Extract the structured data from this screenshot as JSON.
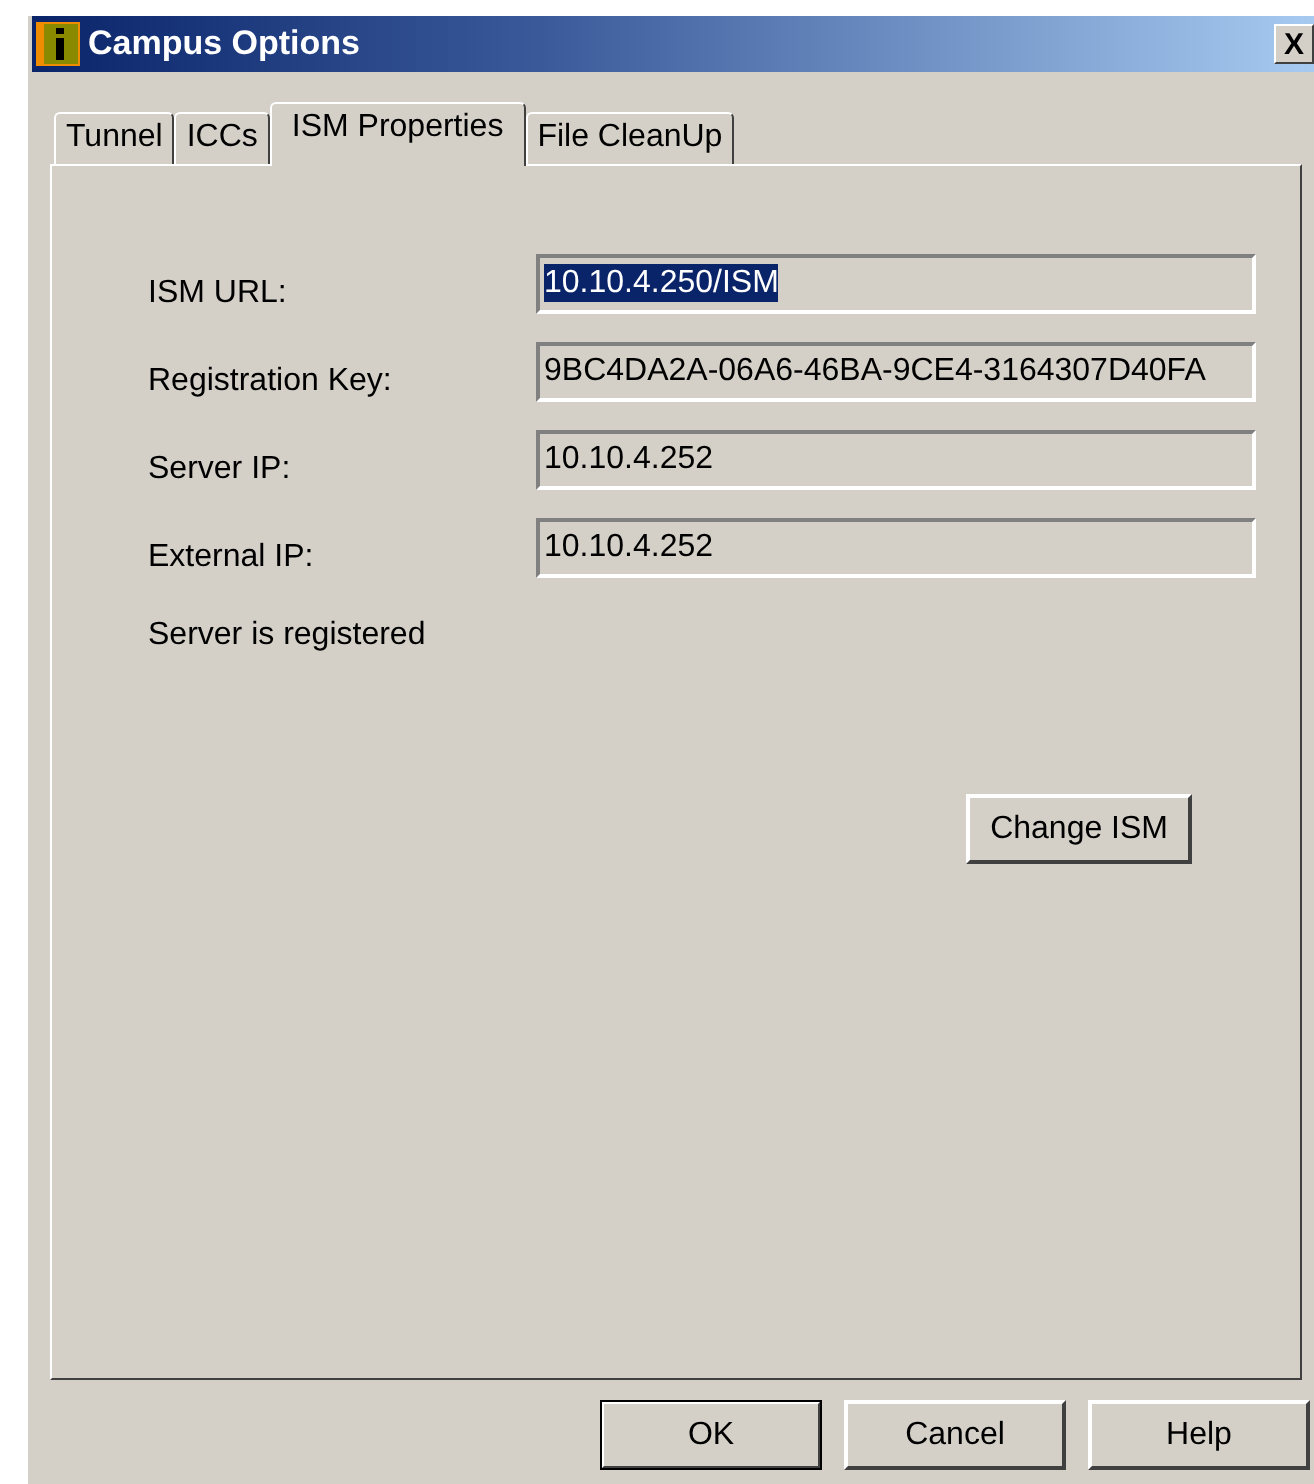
{
  "window": {
    "title": "Campus Options",
    "close": "X"
  },
  "tabs": [
    {
      "label": "Tunnel",
      "selected": false
    },
    {
      "label": "ICCs",
      "selected": false
    },
    {
      "label": "ISM Properties",
      "selected": true
    },
    {
      "label": "File CleanUp",
      "selected": false
    }
  ],
  "fields": [
    {
      "label": "ISM URL:",
      "value": "10.10.4.250/ISM",
      "highlighted": true
    },
    {
      "label": "Registration Key:",
      "value": "9BC4DA2A-06A6-46BA-9CE4-3164307D40FA",
      "highlighted": false
    },
    {
      "label": "Server IP:",
      "value": "10.10.4.252",
      "highlighted": false
    },
    {
      "label": "External IP:",
      "value": "10.10.4.252",
      "highlighted": false
    }
  ],
  "status": "Server is registered",
  "change_button": "Change ISM",
  "buttons": [
    {
      "label": "OK",
      "default": true
    },
    {
      "label": "Cancel",
      "default": false
    },
    {
      "label": "Help",
      "default": false
    }
  ]
}
